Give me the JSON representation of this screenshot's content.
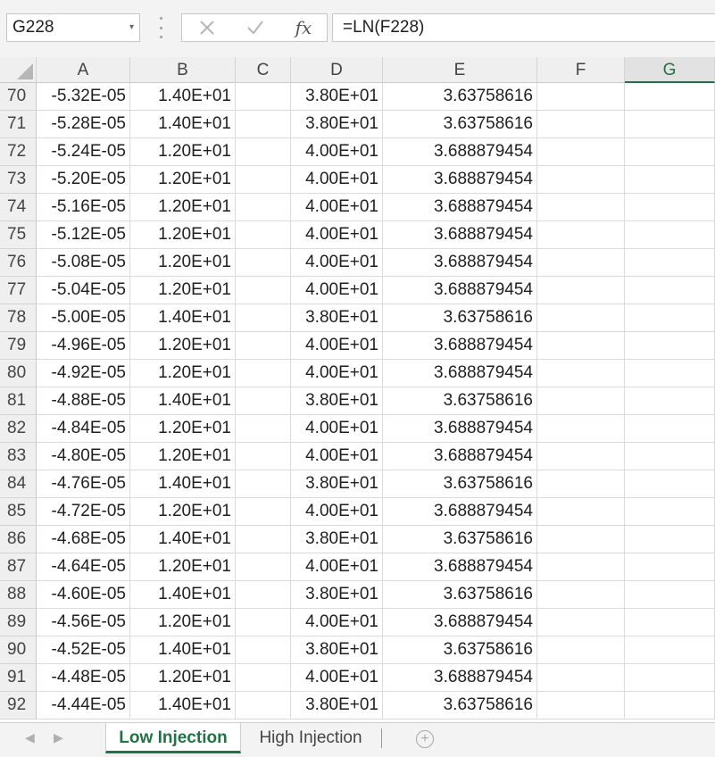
{
  "name_box": {
    "value": "G228"
  },
  "formula_bar": {
    "formula": "=LN(F228)",
    "cancel_icon": "cancel-x-icon",
    "enter_icon": "checkmark-icon",
    "fx_label": "fx"
  },
  "columns": [
    "A",
    "B",
    "C",
    "D",
    "E",
    "F",
    "G"
  ],
  "selected_column": "G",
  "rows": [
    {
      "num": "70",
      "A": "-5.32E-05",
      "B": "1.40E+01",
      "C": "",
      "D": "3.80E+01",
      "E": "3.63758616"
    },
    {
      "num": "71",
      "A": "-5.28E-05",
      "B": "1.40E+01",
      "C": "",
      "D": "3.80E+01",
      "E": "3.63758616"
    },
    {
      "num": "72",
      "A": "-5.24E-05",
      "B": "1.20E+01",
      "C": "",
      "D": "4.00E+01",
      "E": "3.688879454"
    },
    {
      "num": "73",
      "A": "-5.20E-05",
      "B": "1.20E+01",
      "C": "",
      "D": "4.00E+01",
      "E": "3.688879454"
    },
    {
      "num": "74",
      "A": "-5.16E-05",
      "B": "1.20E+01",
      "C": "",
      "D": "4.00E+01",
      "E": "3.688879454"
    },
    {
      "num": "75",
      "A": "-5.12E-05",
      "B": "1.20E+01",
      "C": "",
      "D": "4.00E+01",
      "E": "3.688879454"
    },
    {
      "num": "76",
      "A": "-5.08E-05",
      "B": "1.20E+01",
      "C": "",
      "D": "4.00E+01",
      "E": "3.688879454"
    },
    {
      "num": "77",
      "A": "-5.04E-05",
      "B": "1.20E+01",
      "C": "",
      "D": "4.00E+01",
      "E": "3.688879454"
    },
    {
      "num": "78",
      "A": "-5.00E-05",
      "B": "1.40E+01",
      "C": "",
      "D": "3.80E+01",
      "E": "3.63758616"
    },
    {
      "num": "79",
      "A": "-4.96E-05",
      "B": "1.20E+01",
      "C": "",
      "D": "4.00E+01",
      "E": "3.688879454"
    },
    {
      "num": "80",
      "A": "-4.92E-05",
      "B": "1.20E+01",
      "C": "",
      "D": "4.00E+01",
      "E": "3.688879454"
    },
    {
      "num": "81",
      "A": "-4.88E-05",
      "B": "1.40E+01",
      "C": "",
      "D": "3.80E+01",
      "E": "3.63758616"
    },
    {
      "num": "82",
      "A": "-4.84E-05",
      "B": "1.20E+01",
      "C": "",
      "D": "4.00E+01",
      "E": "3.688879454"
    },
    {
      "num": "83",
      "A": "-4.80E-05",
      "B": "1.20E+01",
      "C": "",
      "D": "4.00E+01",
      "E": "3.688879454"
    },
    {
      "num": "84",
      "A": "-4.76E-05",
      "B": "1.40E+01",
      "C": "",
      "D": "3.80E+01",
      "E": "3.63758616"
    },
    {
      "num": "85",
      "A": "-4.72E-05",
      "B": "1.20E+01",
      "C": "",
      "D": "4.00E+01",
      "E": "3.688879454"
    },
    {
      "num": "86",
      "A": "-4.68E-05",
      "B": "1.40E+01",
      "C": "",
      "D": "3.80E+01",
      "E": "3.63758616"
    },
    {
      "num": "87",
      "A": "-4.64E-05",
      "B": "1.20E+01",
      "C": "",
      "D": "4.00E+01",
      "E": "3.688879454"
    },
    {
      "num": "88",
      "A": "-4.60E-05",
      "B": "1.40E+01",
      "C": "",
      "D": "3.80E+01",
      "E": "3.63758616"
    },
    {
      "num": "89",
      "A": "-4.56E-05",
      "B": "1.20E+01",
      "C": "",
      "D": "4.00E+01",
      "E": "3.688879454"
    },
    {
      "num": "90",
      "A": "-4.52E-05",
      "B": "1.40E+01",
      "C": "",
      "D": "3.80E+01",
      "E": "3.63758616"
    },
    {
      "num": "91",
      "A": "-4.48E-05",
      "B": "1.20E+01",
      "C": "",
      "D": "4.00E+01",
      "E": "3.688879454"
    },
    {
      "num": "92",
      "A": "-4.44E-05",
      "B": "1.40E+01",
      "C": "",
      "D": "3.80E+01",
      "E": "3.63758616"
    }
  ],
  "sheet_tabs": [
    {
      "label": "Low Injection",
      "active": true
    },
    {
      "label": "High Injection",
      "active": false
    }
  ],
  "colors": {
    "accent": "#217346",
    "header_bg": "#efefef",
    "gridline": "#dadada"
  }
}
